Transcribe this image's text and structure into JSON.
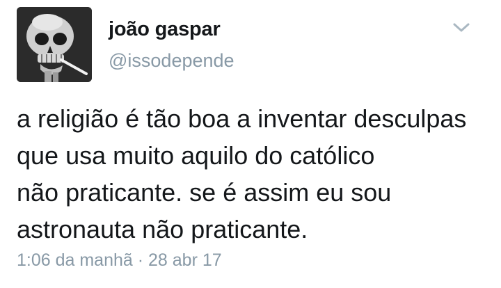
{
  "author": {
    "display_name": "joão gaspar",
    "handle": "@issodepende",
    "avatar_icon": "skull-with-cigarette-avatar"
  },
  "menu": {
    "icon": "chevron-down-icon"
  },
  "tweet": {
    "lines": [
      "a religião é tão boa a inventar desculpas",
      "que usa muito aquilo do católico",
      "não praticante. se é assim eu sou",
      "astronauta não praticante."
    ],
    "timestamp": "1:06 da manhã · 28 abr 17"
  },
  "colors": {
    "text": "#14171a",
    "secondary": "#8899a6"
  }
}
